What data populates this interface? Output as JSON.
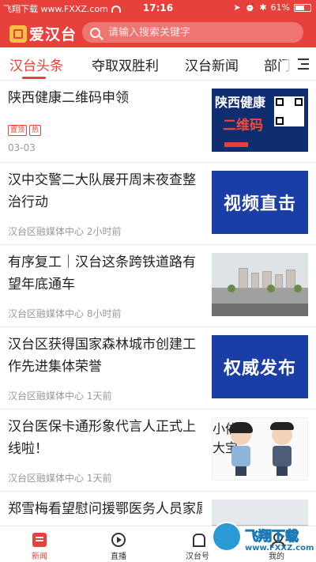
{
  "status_bar": {
    "left_text": "飞翔下载 www.FXXZ.com",
    "time": "17:16",
    "battery": "61%",
    "battery_level": 0.61
  },
  "header": {
    "logo": "爱汉台",
    "search_placeholder": "请输入搜索关键字"
  },
  "tabs": [
    {
      "label": "汉台头条",
      "active": true
    },
    {
      "label": "夺取双胜利",
      "active": false
    },
    {
      "label": "汉台新闻",
      "active": false
    },
    {
      "label": "部门",
      "active": false
    }
  ],
  "news": [
    {
      "title": "陕西健康二维码申领",
      "badges": [
        "置顶",
        "热"
      ],
      "meta": "03-03",
      "thumb": {
        "kind": "qr",
        "line1": "陕西健康",
        "line2": "二维码"
      }
    },
    {
      "title": "汉中交警二大队展开周末夜查整治行动",
      "meta": "汉台区融媒体中心 2小时前",
      "thumb": {
        "kind": "blue",
        "text": "视频直击"
      }
    },
    {
      "title": "有序复工｜汉台这条跨铁道路有望年底通车",
      "meta": "汉台区融媒体中心 8小时前",
      "thumb": {
        "kind": "road"
      }
    },
    {
      "title": "汉台区获得国家森林城市创建工作先进集体荣誉",
      "meta": "汉台区融媒体中心 1天前",
      "thumb": {
        "kind": "blue",
        "text": "权威发布"
      }
    },
    {
      "title": "汉台医保卡通形象代言人正式上线啦！",
      "meta": "汉台区融媒体中心 1天前",
      "thumb": {
        "kind": "cartoon",
        "left_caption": "小依",
        "right_caption": "大宝"
      }
    },
    {
      "title": "郑雪梅看望慰问援鄂医务人员家属",
      "meta": "",
      "thumb": {
        "kind": "photo"
      }
    }
  ],
  "bottom_nav": [
    {
      "label": "新闻",
      "icon": "news-icon",
      "active": true
    },
    {
      "label": "直播",
      "icon": "live-icon",
      "active": false
    },
    {
      "label": "汉台号",
      "icon": "hantai-hao-icon",
      "active": false
    },
    {
      "label": "我的",
      "icon": "profile-icon",
      "active": false
    }
  ],
  "watermark": {
    "text": "飞翔下载",
    "url": "www.FXXZ.com"
  },
  "colors": {
    "brand": "#e8403a",
    "banner_blue": "#1a3ea5",
    "meta_gray": "#999999"
  }
}
